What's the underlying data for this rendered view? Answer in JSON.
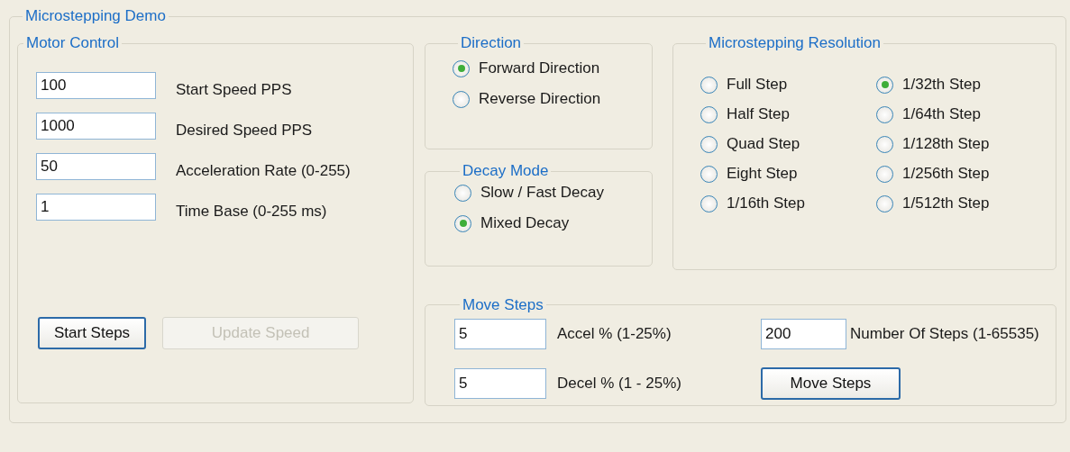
{
  "window": {
    "title": "Microstepping Demo"
  },
  "motor_control": {
    "title": "Motor Control",
    "fields": [
      {
        "value": "100",
        "label": "Start Speed PPS"
      },
      {
        "value": "1000",
        "label": "Desired Speed PPS"
      },
      {
        "value": "50",
        "label": "Acceleration Rate (0-255)"
      },
      {
        "value": "1",
        "label": "Time Base (0-255 ms)"
      }
    ],
    "buttons": [
      {
        "label": "Start Steps",
        "disabled": false
      },
      {
        "label": "Update Speed",
        "disabled": true
      }
    ]
  },
  "direction": {
    "title": "Direction",
    "options": [
      {
        "label": "Forward Direction",
        "selected": true
      },
      {
        "label": "Reverse Direction",
        "selected": false
      }
    ]
  },
  "decay_mode": {
    "title": "Decay Mode",
    "options": [
      {
        "label": "Slow / Fast Decay",
        "selected": false
      },
      {
        "label": "Mixed Decay",
        "selected": true
      }
    ]
  },
  "resolution": {
    "title": "Microstepping Resolution",
    "options": [
      {
        "label": "Full Step",
        "selected": false
      },
      {
        "label": "Half Step",
        "selected": false
      },
      {
        "label": "Quad Step",
        "selected": false
      },
      {
        "label": "Eight Step",
        "selected": false
      },
      {
        "label": "1/16th Step",
        "selected": false
      },
      {
        "label": "1/32th Step",
        "selected": true
      },
      {
        "label": "1/64th Step",
        "selected": false
      },
      {
        "label": "1/128th Step",
        "selected": false
      },
      {
        "label": "1/256th Step",
        "selected": false
      },
      {
        "label": "1/512th Step",
        "selected": false
      }
    ]
  },
  "move_steps": {
    "title": "Move Steps",
    "fields": [
      {
        "value": "5",
        "label": "Accel % (1-25%)"
      },
      {
        "value": "5",
        "label": "Decel % (1 - 25%)"
      }
    ],
    "steps_field": {
      "value": "200",
      "label": "Number Of Steps (1-65535)"
    },
    "button": {
      "label": "Move Steps",
      "disabled": false
    }
  }
}
